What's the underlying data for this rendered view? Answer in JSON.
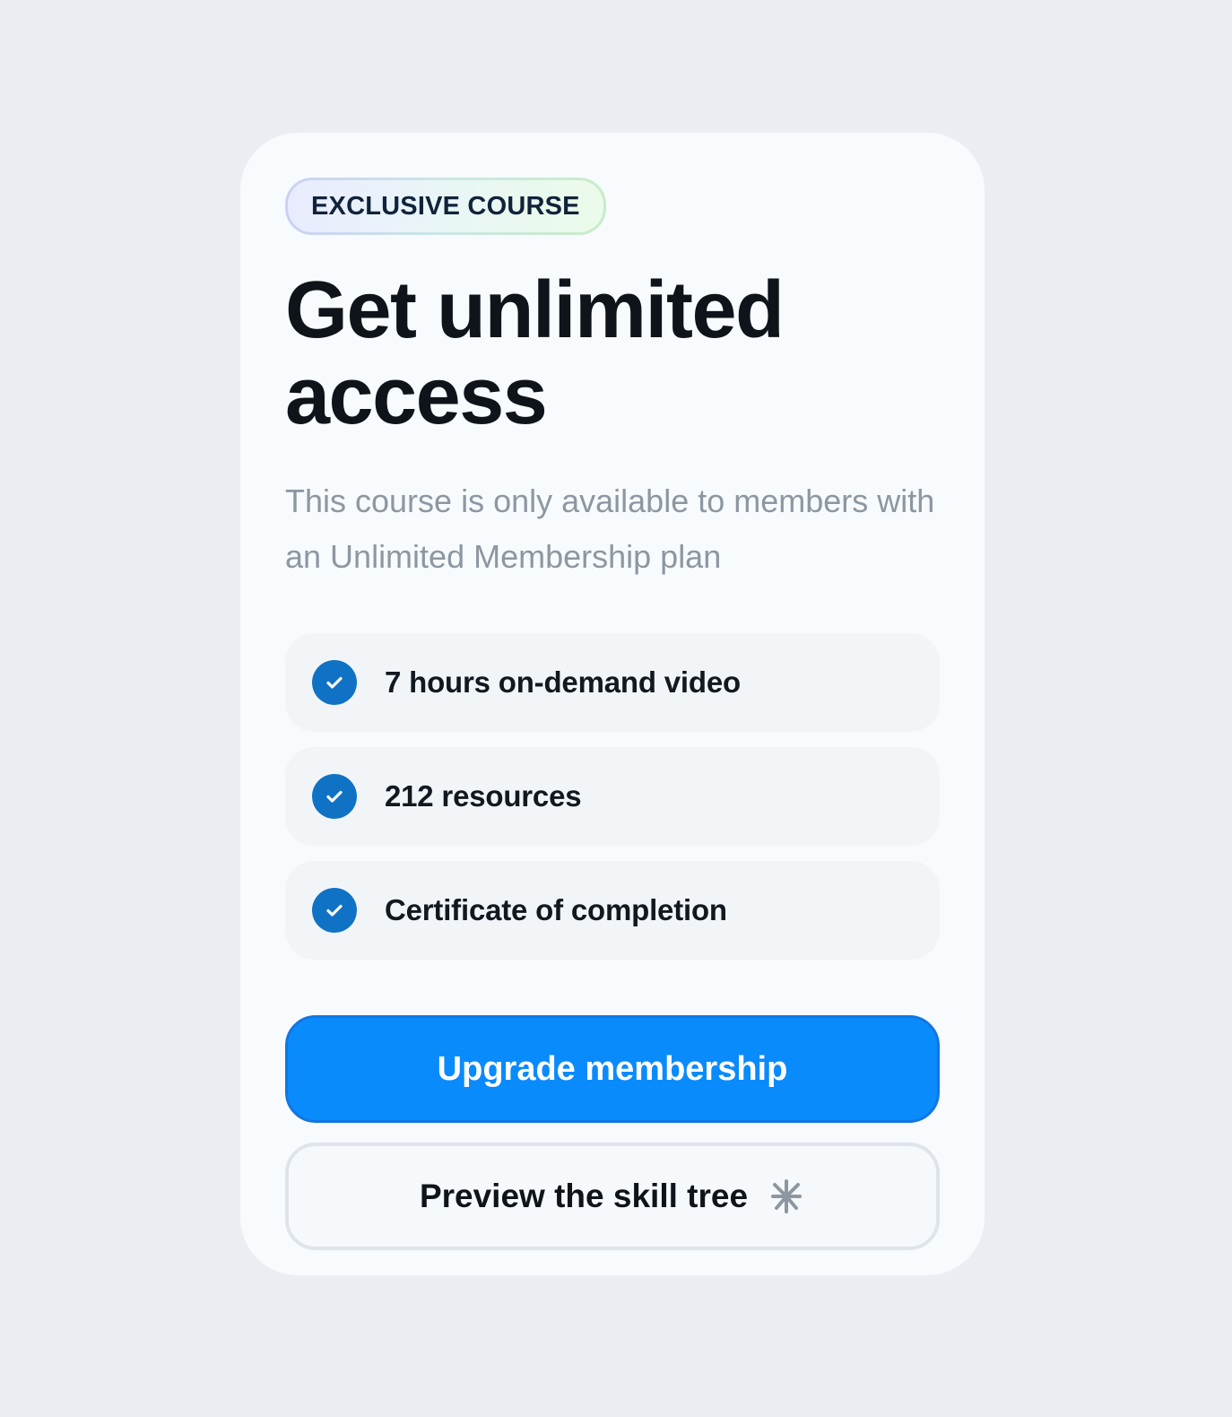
{
  "badge": {
    "label": "EXCLUSIVE COURSE"
  },
  "heading": {
    "title": "Get unlimited access",
    "subtitle": "This course is only available to members with an Unlimited Membership plan"
  },
  "features": [
    {
      "label": "7 hours on-demand video",
      "icon": "check-circle-icon"
    },
    {
      "label": "212 resources",
      "icon": "check-circle-icon"
    },
    {
      "label": "Certificate of completion",
      "icon": "check-circle-icon"
    }
  ],
  "actions": {
    "primary_label": "Upgrade membership",
    "secondary_label": "Preview the skill tree",
    "secondary_icon": "skill-tree-icon"
  },
  "colors": {
    "background": "#eaedf1",
    "card": "#f7fbfe",
    "accent": "#0a8bfc",
    "check": "#1072c4",
    "text_primary": "#0f141a",
    "text_muted": "#8d97a1"
  }
}
